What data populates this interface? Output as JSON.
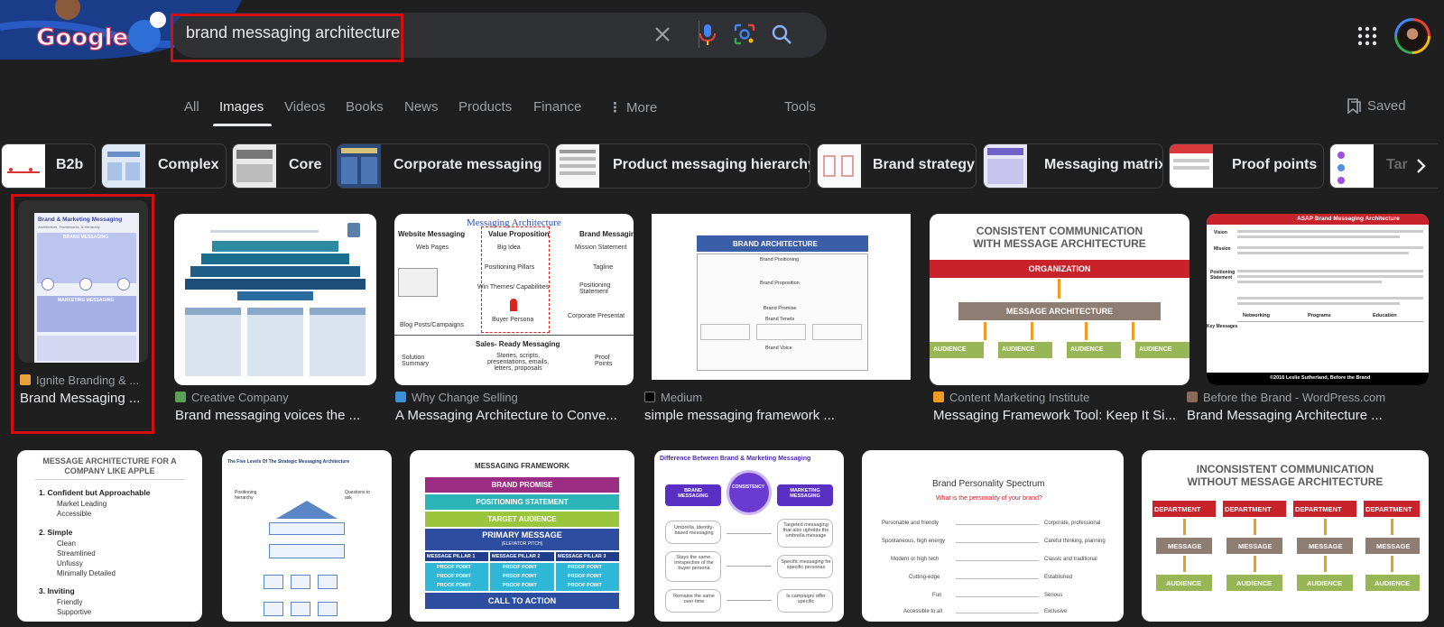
{
  "search": {
    "query": "brand messaging architecture"
  },
  "tabs": [
    {
      "label": "All"
    },
    {
      "label": "Images"
    },
    {
      "label": "Videos"
    },
    {
      "label": "Books"
    },
    {
      "label": "News"
    },
    {
      "label": "Products"
    },
    {
      "label": "Finance"
    },
    {
      "label": "More"
    },
    {
      "label": "Tools"
    }
  ],
  "active_tab": "Images",
  "saved_label": "Saved",
  "chips": [
    {
      "label": "B2b"
    },
    {
      "label": "Complex"
    },
    {
      "label": "Core"
    },
    {
      "label": "Corporate messaging"
    },
    {
      "label": "Product messaging hierarchy"
    },
    {
      "label": "Brand strategy"
    },
    {
      "label": "Messaging matrix"
    },
    {
      "label": "Proof points"
    },
    {
      "label": "Tar"
    }
  ],
  "results_row1": [
    {
      "source": "Ignite Branding & ...",
      "title": "Brand Messaging ...",
      "fav_color": "#e9a23b"
    },
    {
      "source": "Creative Company",
      "title": "Brand messaging voices the ...",
      "fav_color": "#5aa25a"
    },
    {
      "source": "Why Change Selling",
      "title": "A Messaging Architecture to Conve...",
      "fav_color": "#3b8fd6"
    },
    {
      "source": "Medium",
      "title": "simple messaging framework ...",
      "fav_color": "#000000"
    },
    {
      "source": "Content Marketing Institute",
      "title": "Messaging Framework Tool: Keep It Si...",
      "fav_color": "#f29b22"
    },
    {
      "source": "Before the Brand - WordPress.com",
      "title": "Brand Messaging Architecture ...",
      "fav_color": "#8a6a5a"
    }
  ],
  "thumb_text": {
    "ignite": {
      "title": "Brand & Marketing Messaging",
      "sub": "Architecture, Frameworks, & Hierarchy",
      "brand": "BRAND MESSAGING",
      "marketing": "MARKETING MESSAGING"
    },
    "wcs": {
      "title": "Messaging Architecture",
      "col1": "Website Messaging",
      "col2": "Value Proposition",
      "col3": "Brand Messaging",
      "items1": [
        "Web Pages",
        "Blog Posts/Campaigns"
      ],
      "items2": [
        "Big Idea",
        "Positioning Pillars",
        "Win Themes/ Capabilities",
        "Buyer Persona"
      ],
      "items3": [
        "Mission Statement",
        "Tagline",
        "Positioning Statement",
        "Corporate Presentat"
      ],
      "bottom": "Sales- Ready Messaging",
      "bottom_sub": "Stories, scripts, presentations, emails, letters, proposals",
      "left": "Solution Summary",
      "right": "Proof Points"
    },
    "medium": {
      "head": "BRAND ARCHITECTURE",
      "rows": [
        "Brand Positioning",
        "Brand Proposition",
        "Brand Promise",
        "Brand Tenets",
        "Brand Voice"
      ]
    },
    "cmi": {
      "title": "CONSISTENT COMMUNICATION WITH MESSAGE ARCHITECTURE",
      "org": "ORGANIZATION",
      "arch": "MESSAGE ARCHITECTURE",
      "aud": "AUDIENCE"
    },
    "btb": {
      "title": "ASAP Brand Messaging Architecture",
      "labels": [
        "Vision",
        "Mission",
        "Positioning Statement",
        "Key Messages"
      ],
      "cols": [
        "Networking",
        "Programs",
        "Education"
      ],
      "footer": "©2016 Leslie Sutherland, Before the Brand"
    },
    "apple": {
      "title": "MESSAGE ARCHITECTURE FOR A COMPANY LIKE APPLE",
      "sections": [
        {
          "head": "1. Confident but Approachable",
          "items": [
            "Market Leading",
            "Accessible"
          ]
        },
        {
          "head": "2. Simple",
          "items": [
            "Clean",
            "Streamlined",
            "Unfussy",
            "Minimally Detailed"
          ]
        },
        {
          "head": "3. Inviting",
          "items": [
            "Friendly",
            "Supportive"
          ]
        }
      ]
    },
    "levels": {
      "title": "The Five Levels Of The Strategic Messaging Architecture",
      "c1": "Positioning hierarchy",
      "c2": "Questions to ask"
    },
    "framework": {
      "title": "MESSAGING FRAMEWORK",
      "promise": "BRAND PROMISE",
      "positioning": "POSITIONING STATEMENT",
      "audience": "TARGET AUDIENCE",
      "primary": "PRIMARY MESSAGE",
      "primary_sub": "(ELEVATOR PITCH)",
      "pillars": [
        "MESSAGE PILLAR 1",
        "MESSAGE PILLAR 2",
        "MESSAGE PILLAR 3"
      ],
      "proof": "PROOF POINT",
      "cta": "CALL TO ACTION"
    },
    "diff": {
      "title": "Difference Between Brand & Marketing Messaging",
      "left": "BRAND MESSAGING",
      "right": "MARKETING MESSAGING",
      "center": "CONSISTENCY",
      "lrows": [
        "Umbrella, identity-based messaging",
        "Stays the same, irrespective of the buyer persona",
        "Remains the same over time"
      ],
      "rrows": [
        "Targeted messaging that also upholds the umbrella message",
        "Specific messaging for specific personas",
        "Is campaign/ offer specific"
      ]
    },
    "spectrum": {
      "title": "Brand Personality Spectrum",
      "question": "What is the personality of your brand?",
      "left": [
        "Personable and friendly",
        "Spontaneous, high energy",
        "Modern or high tech",
        "Cutting-edge",
        "Fun",
        "Accessible to all"
      ],
      "right": [
        "Corporate, professional",
        "Careful thinking, planning",
        "Classic and traditional",
        "Established",
        "Serious",
        "Exclusive"
      ]
    },
    "incons": {
      "title": "INCONSISTENT COMMUNICATION WITHOUT MESSAGE ARCHITECTURE",
      "dept": "DEPARTMENT",
      "msg": "MESSAGE",
      "aud": "AUDIENCE"
    }
  },
  "colors": {
    "accent_blue": "#8ab4f8",
    "highlight_red": "#d50d0d",
    "background": "#1f1f1f"
  }
}
